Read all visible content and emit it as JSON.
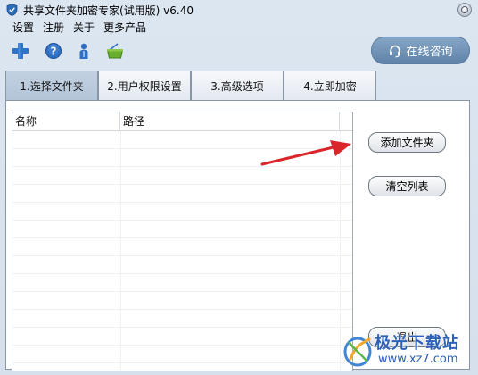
{
  "window": {
    "title": "共享文件夹加密专家(试用版) v6.40"
  },
  "menu": {
    "items": [
      {
        "label": "设置"
      },
      {
        "label": "注册"
      },
      {
        "label": "关于"
      },
      {
        "label": "更多产品"
      }
    ]
  },
  "toolbar": {
    "icons": [
      "add-icon",
      "help-icon",
      "user-icon",
      "basket-icon"
    ]
  },
  "consult_button": {
    "label": "在线咨询",
    "icon": "headset-icon"
  },
  "tabs": [
    {
      "label": "1.选择文件夹",
      "active": true
    },
    {
      "label": "2.用户权限设置",
      "active": false
    },
    {
      "label": "3.高级选项",
      "active": false
    },
    {
      "label": "4.立即加密",
      "active": false
    }
  ],
  "folder_list": {
    "columns": [
      "名称",
      "路径"
    ],
    "rows": []
  },
  "actions": {
    "add_folder": "添加文件夹",
    "clear_list": "清空列表",
    "exit": "退出"
  },
  "watermark": {
    "text": "极光下载站",
    "url": "www.xz7.com"
  },
  "colors": {
    "accent": "#6a8bb1",
    "arrow": "#d8262b",
    "watermark": "#2d61b8"
  }
}
